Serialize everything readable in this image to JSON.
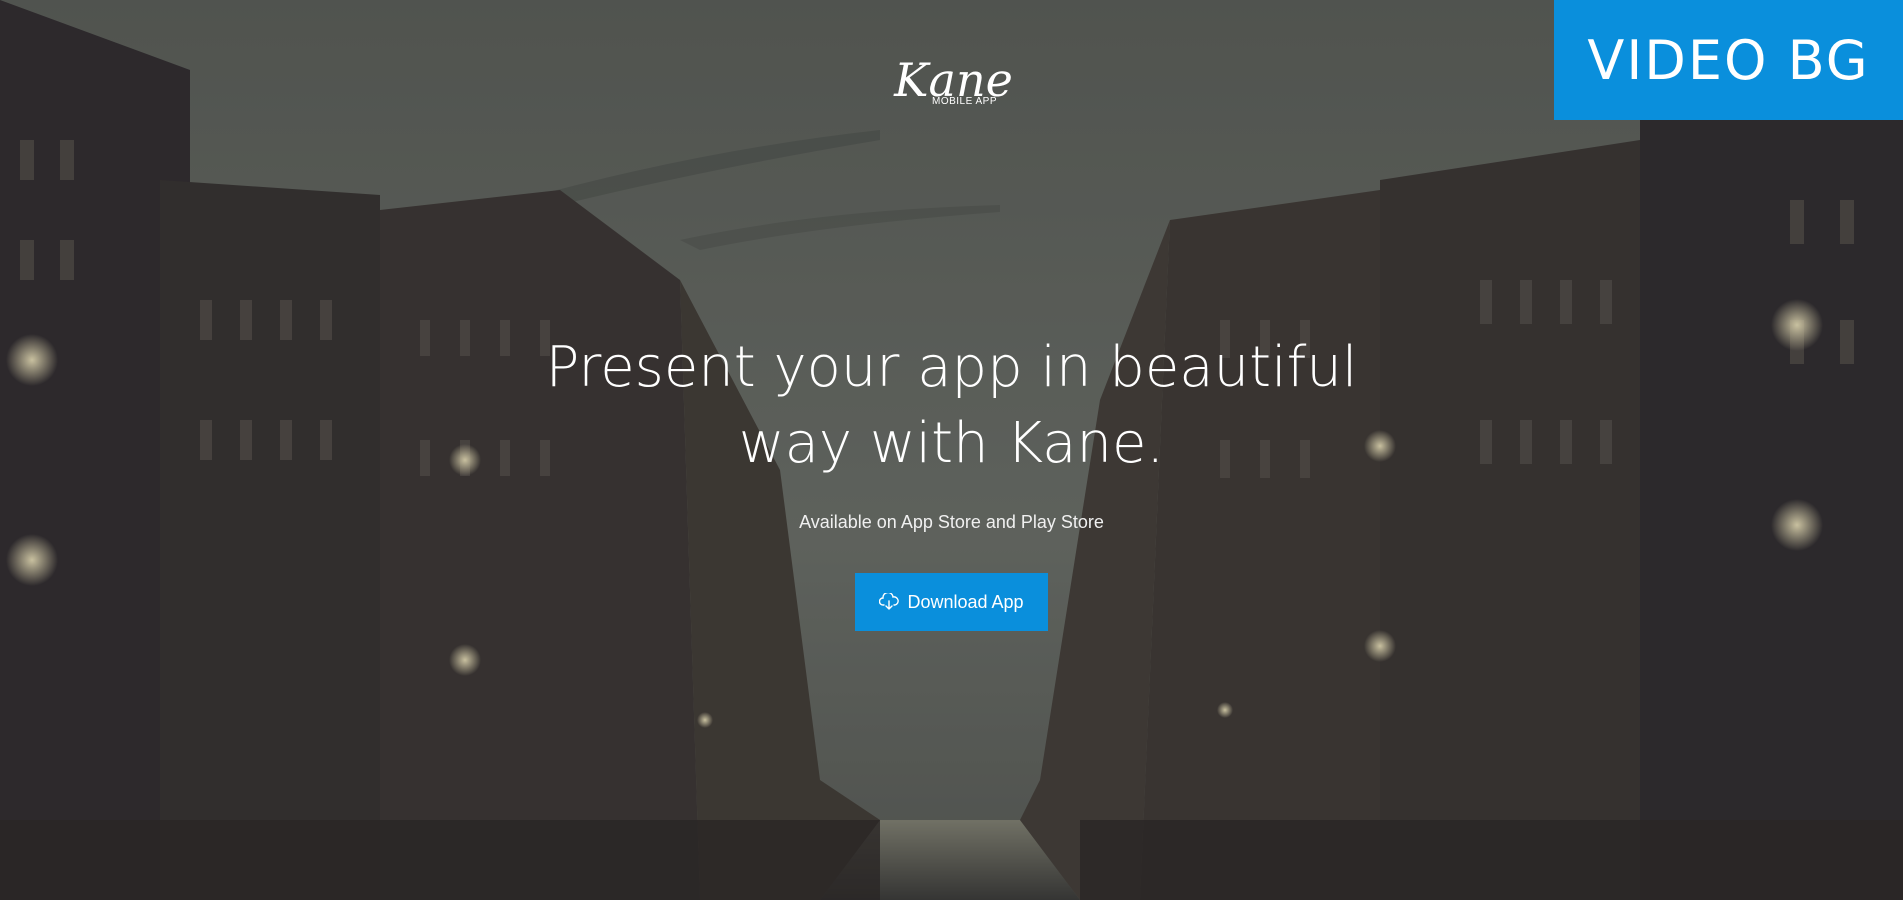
{
  "badge": {
    "label": "VIDEO BG"
  },
  "logo": {
    "wordmark": "Kane",
    "subtitle": "MOBILE APP"
  },
  "hero": {
    "headline_line1": "Present your app in beautiful",
    "headline_line2": "way with Kane.",
    "subtitle": "Available on App Store and Play Store",
    "cta_label": "Download App",
    "cta_icon": "cloud-download-icon"
  },
  "colors": {
    "accent": "#0a8fdc",
    "text": "#ffffff"
  }
}
